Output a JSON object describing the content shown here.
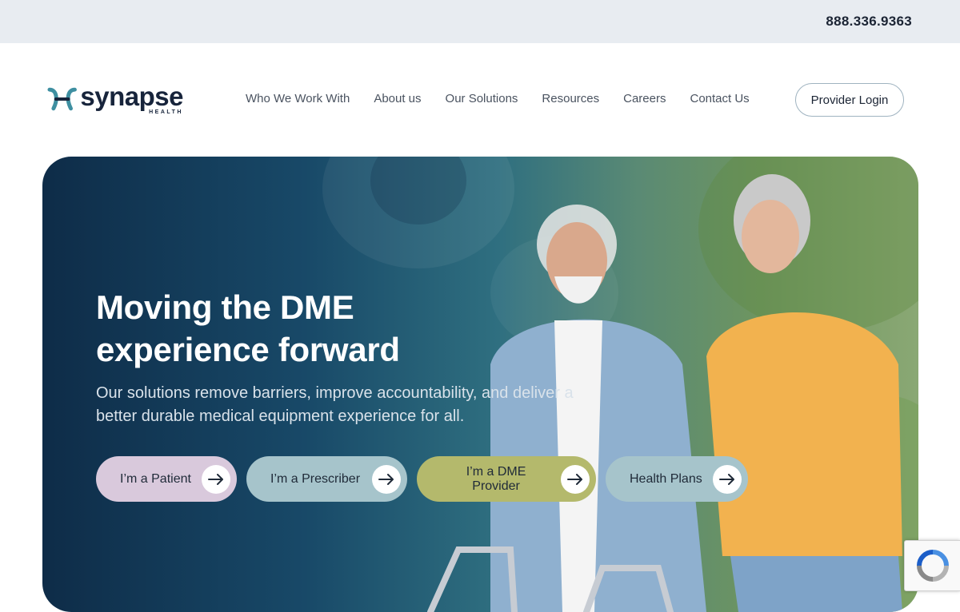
{
  "topbar": {
    "phone": "888.336.9363"
  },
  "logo": {
    "word": "synapse",
    "sub": "HEALTH"
  },
  "nav": {
    "items": [
      {
        "label": "Who We Work With"
      },
      {
        "label": "About us"
      },
      {
        "label": "Our Solutions"
      },
      {
        "label": "Resources"
      },
      {
        "label": "Careers"
      },
      {
        "label": "Contact Us"
      }
    ]
  },
  "header": {
    "login_label": "Provider Login"
  },
  "hero": {
    "title_line1": "Moving the DME",
    "title_line2": "experience forward",
    "subtitle": "Our solutions remove barriers, improve accountability, and deliver a better durable medical equipment experience for all.",
    "ctas": [
      {
        "label": "I’m a Patient",
        "color": "#d9c9dc"
      },
      {
        "label": "I’m a Prescriber",
        "color": "#a6c4cb"
      },
      {
        "label": "I’m a DME Provider",
        "color": "#b4b96c"
      },
      {
        "label": "Health Plans",
        "color": "#a6c4cb"
      }
    ]
  },
  "colors": {
    "brand_navy": "#17243b",
    "brand_teal": "#3e8fa1",
    "hero_dark": "#0e2c48"
  },
  "icons": {
    "cta_arrow": "arrow-right-icon",
    "recaptcha": "recaptcha-icon"
  }
}
